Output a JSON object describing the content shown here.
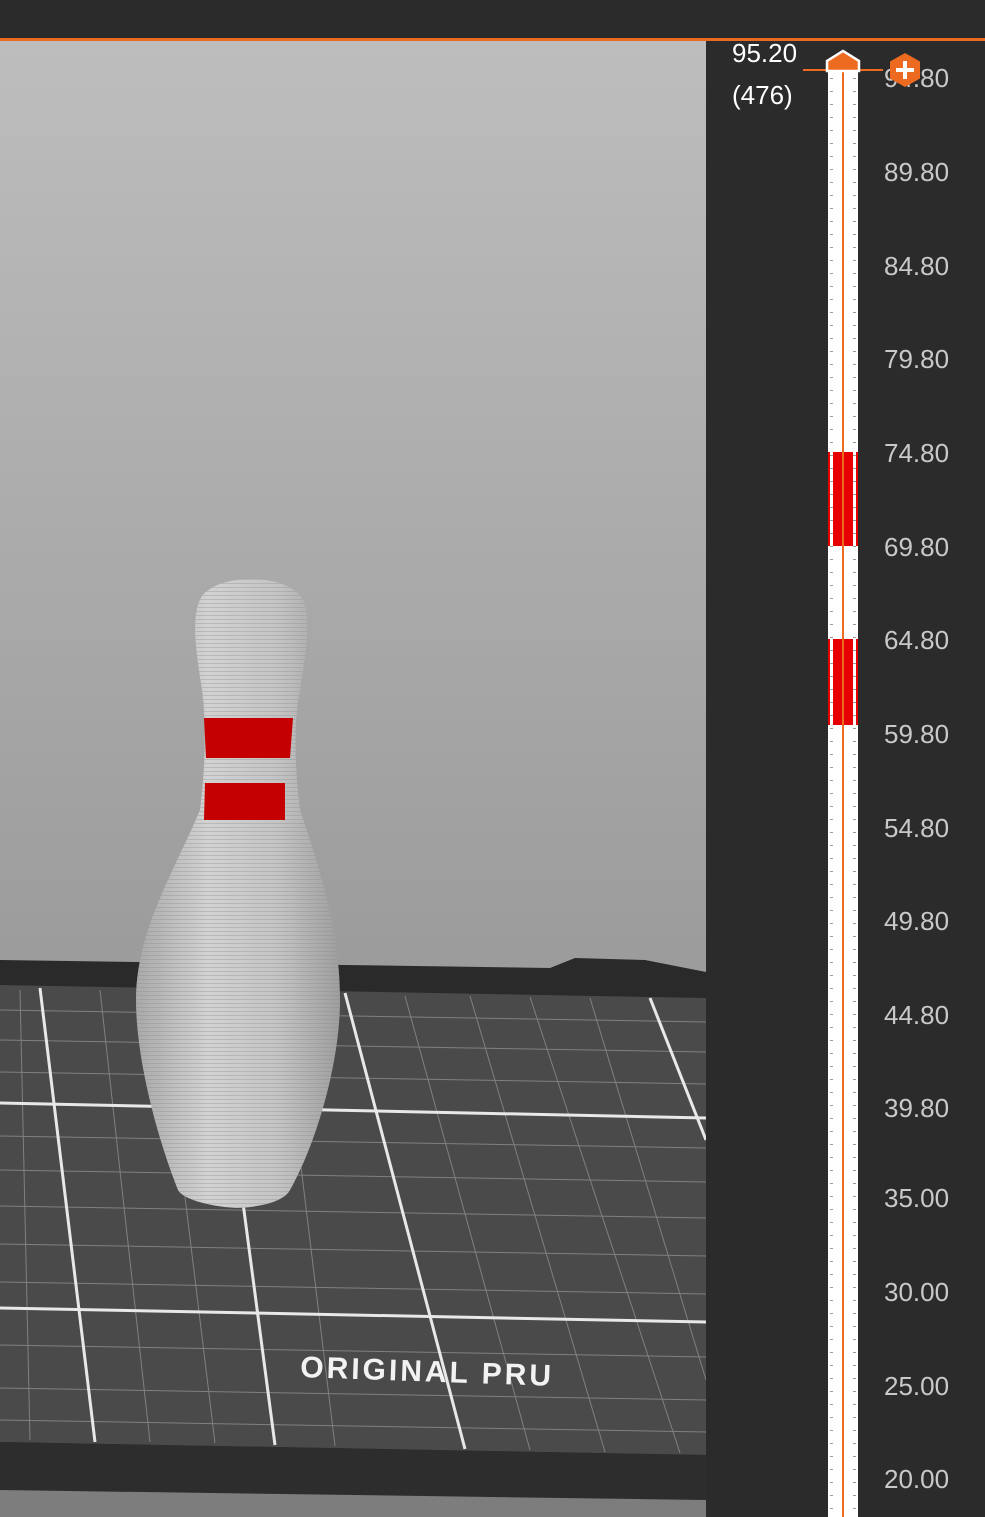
{
  "slider": {
    "current_height": "95.20",
    "current_layer": "(476)",
    "add_icon": "plus-icon",
    "ticks": [
      "94.80",
      "89.80",
      "84.80",
      "79.80",
      "74.80",
      "69.80",
      "64.80",
      "59.80",
      "54.80",
      "49.80",
      "44.80",
      "39.80",
      "35.00",
      "30.00",
      "25.00",
      "20.00"
    ],
    "color_bands": [
      {
        "from": "69.80",
        "to": "74.80",
        "color": "#e60000"
      },
      {
        "from": "59.80",
        "to": "64.80",
        "color": "#e60000"
      }
    ]
  },
  "bed": {
    "label": "ORIGINAL PRU"
  },
  "colors": {
    "accent": "#ed6b21",
    "band": "#e60000",
    "panel": "#2b2b2b",
    "object": "#c8c8c8"
  }
}
